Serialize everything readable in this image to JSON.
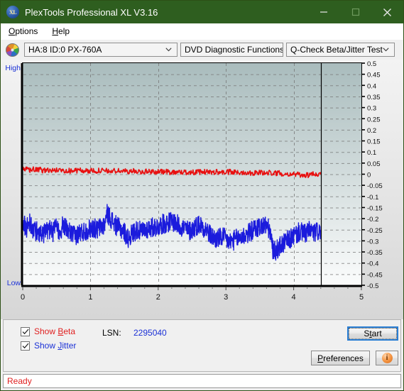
{
  "window": {
    "title": "PlexTools Professional XL V3.16",
    "app_icon": "xl-disc-icon",
    "icon_text": "XL",
    "minimize_label": "Minimize",
    "maximize_label": "Maximize",
    "close_label": "Close",
    "titlebar_color": "#2e5e1f"
  },
  "menubar": {
    "items": [
      {
        "label": "Options",
        "accel": "O"
      },
      {
        "label": "Help",
        "accel": "H"
      }
    ]
  },
  "toolbar": {
    "drive_icon": "disc-icon",
    "drive_selector": {
      "value": "HA:8 ID:0  PX-760A",
      "options": [
        "HA:8 ID:0  PX-760A"
      ]
    },
    "function_selector": {
      "value": "DVD Diagnostic Functions",
      "options": [
        "DVD Diagnostic Functions"
      ]
    },
    "test_selector": {
      "value": "Q-Check Beta/Jitter Test",
      "options": [
        "Q-Check Beta/Jitter Test"
      ]
    }
  },
  "chart_data": {
    "type": "line",
    "title": "",
    "xlabel": "",
    "ylabel": "",
    "xlim": [
      0,
      5
    ],
    "ylim": [
      -0.5,
      0.5
    ],
    "x_ticks": [
      0,
      1,
      2,
      3,
      4,
      5
    ],
    "x_tick_labels": [
      "0",
      "1",
      "2",
      "3",
      "4",
      "5"
    ],
    "y_ticks": [
      0.5,
      0.45,
      0.4,
      0.35,
      0.3,
      0.25,
      0.2,
      0.15,
      0.1,
      0.05,
      0,
      -0.05,
      -0.1,
      -0.15,
      -0.2,
      -0.25,
      -0.3,
      -0.35,
      -0.4,
      -0.45,
      -0.5
    ],
    "y_tick_labels": [
      "0.5",
      "0.45",
      "0.4",
      "0.35",
      "0.3",
      "0.25",
      "0.2",
      "0.15",
      "0.1",
      "0.05",
      "0",
      "-0.05",
      "-0.1",
      "-0.15",
      "-0.2",
      "-0.25",
      "-0.3",
      "-0.35",
      "-0.4",
      "-0.45",
      "-0.5"
    ],
    "axis_top_label": "High",
    "axis_bottom_label": "Low",
    "grid": true,
    "grid_style": "dashed",
    "grid_color": "#777777",
    "plot_background_gradient": [
      "#a9bcbd",
      "#fbfcfc"
    ],
    "data_end_x": 4.4,
    "data_end_marker": true,
    "legend_position": "external-checkboxes",
    "series": [
      {
        "name": "Beta",
        "color": "#e81010",
        "x": [
          0.0,
          0.05,
          0.1,
          0.15,
          0.2,
          0.25,
          0.3,
          0.35,
          0.4,
          0.45,
          0.5,
          0.55,
          0.6,
          0.65,
          0.7,
          0.75,
          0.8,
          0.85,
          0.9,
          0.95,
          1.0,
          1.05,
          1.1,
          1.15,
          1.2,
          1.25,
          1.3,
          1.35,
          1.4,
          1.45,
          1.5,
          1.55,
          1.6,
          1.65,
          1.7,
          1.75,
          1.8,
          1.85,
          1.9,
          1.95,
          2.0,
          2.05,
          2.1,
          2.15,
          2.2,
          2.25,
          2.3,
          2.35,
          2.4,
          2.45,
          2.5,
          2.55,
          2.6,
          2.65,
          2.7,
          2.75,
          2.8,
          2.85,
          2.9,
          2.95,
          3.0,
          3.05,
          3.1,
          3.15,
          3.2,
          3.25,
          3.3,
          3.35,
          3.4,
          3.45,
          3.5,
          3.55,
          3.6,
          3.65,
          3.7,
          3.75,
          3.8,
          3.85,
          3.9,
          3.95,
          4.0,
          4.05,
          4.1,
          4.15,
          4.2,
          4.25,
          4.3,
          4.35,
          4.4
        ],
        "y": [
          0.02,
          0.021,
          0.019,
          0.022,
          0.018,
          0.02,
          0.017,
          0.019,
          0.016,
          0.018,
          0.017,
          0.019,
          0.016,
          0.018,
          0.015,
          0.017,
          0.016,
          0.018,
          0.015,
          0.016,
          0.014,
          0.016,
          0.015,
          0.017,
          0.014,
          0.015,
          0.013,
          0.015,
          0.014,
          0.016,
          0.013,
          0.014,
          0.012,
          0.014,
          0.013,
          0.012,
          0.011,
          0.013,
          0.012,
          0.011,
          0.01,
          0.012,
          0.011,
          0.01,
          0.009,
          0.011,
          0.01,
          0.009,
          0.008,
          0.01,
          0.009,
          0.008,
          0.01,
          0.009,
          0.011,
          0.01,
          0.009,
          0.011,
          0.01,
          0.009,
          0.008,
          0.01,
          0.009,
          0.008,
          0.007,
          0.009,
          0.008,
          0.007,
          0.006,
          0.008,
          0.007,
          0.006,
          0.005,
          0.007,
          0.006,
          0.005,
          0.004,
          0.003,
          0.002,
          0.001,
          0.0,
          -0.002,
          -0.004,
          -0.003,
          -0.005,
          -0.004,
          0.002,
          0.001,
          0.0
        ]
      },
      {
        "name": "Jitter",
        "color": "#1b1bdc",
        "x": [
          0.0,
          0.05,
          0.1,
          0.15,
          0.2,
          0.25,
          0.3,
          0.35,
          0.4,
          0.45,
          0.5,
          0.55,
          0.6,
          0.65,
          0.7,
          0.75,
          0.8,
          0.85,
          0.9,
          0.95,
          1.0,
          1.05,
          1.1,
          1.15,
          1.2,
          1.25,
          1.3,
          1.35,
          1.4,
          1.45,
          1.5,
          1.55,
          1.6,
          1.65,
          1.7,
          1.75,
          1.8,
          1.85,
          1.9,
          1.95,
          2.0,
          2.05,
          2.1,
          2.15,
          2.2,
          2.25,
          2.3,
          2.35,
          2.4,
          2.45,
          2.5,
          2.55,
          2.6,
          2.65,
          2.7,
          2.75,
          2.8,
          2.85,
          2.9,
          2.95,
          3.0,
          3.05,
          3.1,
          3.15,
          3.2,
          3.25,
          3.3,
          3.35,
          3.4,
          3.45,
          3.5,
          3.55,
          3.6,
          3.65,
          3.7,
          3.75,
          3.8,
          3.85,
          3.9,
          3.95,
          4.0,
          4.05,
          4.1,
          4.15,
          4.2,
          4.25,
          4.3,
          4.35,
          4.4
        ],
        "y": [
          -0.215,
          -0.245,
          -0.215,
          -0.25,
          -0.255,
          -0.262,
          -0.27,
          -0.258,
          -0.248,
          -0.262,
          -0.24,
          -0.258,
          -0.228,
          -0.252,
          -0.262,
          -0.278,
          -0.272,
          -0.262,
          -0.258,
          -0.25,
          -0.245,
          -0.24,
          -0.252,
          -0.236,
          -0.232,
          -0.176,
          -0.2,
          -0.222,
          -0.238,
          -0.248,
          -0.258,
          -0.29,
          -0.272,
          -0.258,
          -0.248,
          -0.262,
          -0.25,
          -0.244,
          -0.24,
          -0.238,
          -0.235,
          -0.226,
          -0.222,
          -0.216,
          -0.212,
          -0.218,
          -0.23,
          -0.238,
          -0.244,
          -0.256,
          -0.25,
          -0.235,
          -0.226,
          -0.232,
          -0.248,
          -0.268,
          -0.282,
          -0.292,
          -0.288,
          -0.282,
          -0.292,
          -0.306,
          -0.3,
          -0.292,
          -0.286,
          -0.28,
          -0.272,
          -0.262,
          -0.252,
          -0.242,
          -0.236,
          -0.232,
          -0.23,
          -0.26,
          -0.35,
          -0.34,
          -0.325,
          -0.312,
          -0.3,
          -0.292,
          -0.278,
          -0.268,
          -0.258,
          -0.27,
          -0.262,
          -0.252,
          -0.266,
          -0.258,
          -0.254
        ]
      }
    ],
    "series_noise": [
      0.012,
      0.045
    ]
  },
  "controls": {
    "show_beta": {
      "label_prefix": "Show ",
      "label_accel": "B",
      "label_suffix": "eta",
      "checked": true,
      "color": "#e02020"
    },
    "show_jitter": {
      "label_prefix": "Show ",
      "label_accel": "J",
      "label_suffix": "itter",
      "checked": true,
      "color": "#1b31d6"
    },
    "lsn_label": "LSN:",
    "lsn_value": "2295040",
    "start_button": {
      "prefix": "S",
      "accel": "t",
      "suffix": "art",
      "label": "Start",
      "focused": true
    },
    "preferences_button": {
      "prefix": "",
      "accel": "P",
      "suffix": "references",
      "label": "Preferences"
    },
    "info_button": {
      "icon": "info-icon",
      "glyph": "i"
    }
  },
  "statusbar": {
    "text": "Ready",
    "color": "#e02020"
  }
}
